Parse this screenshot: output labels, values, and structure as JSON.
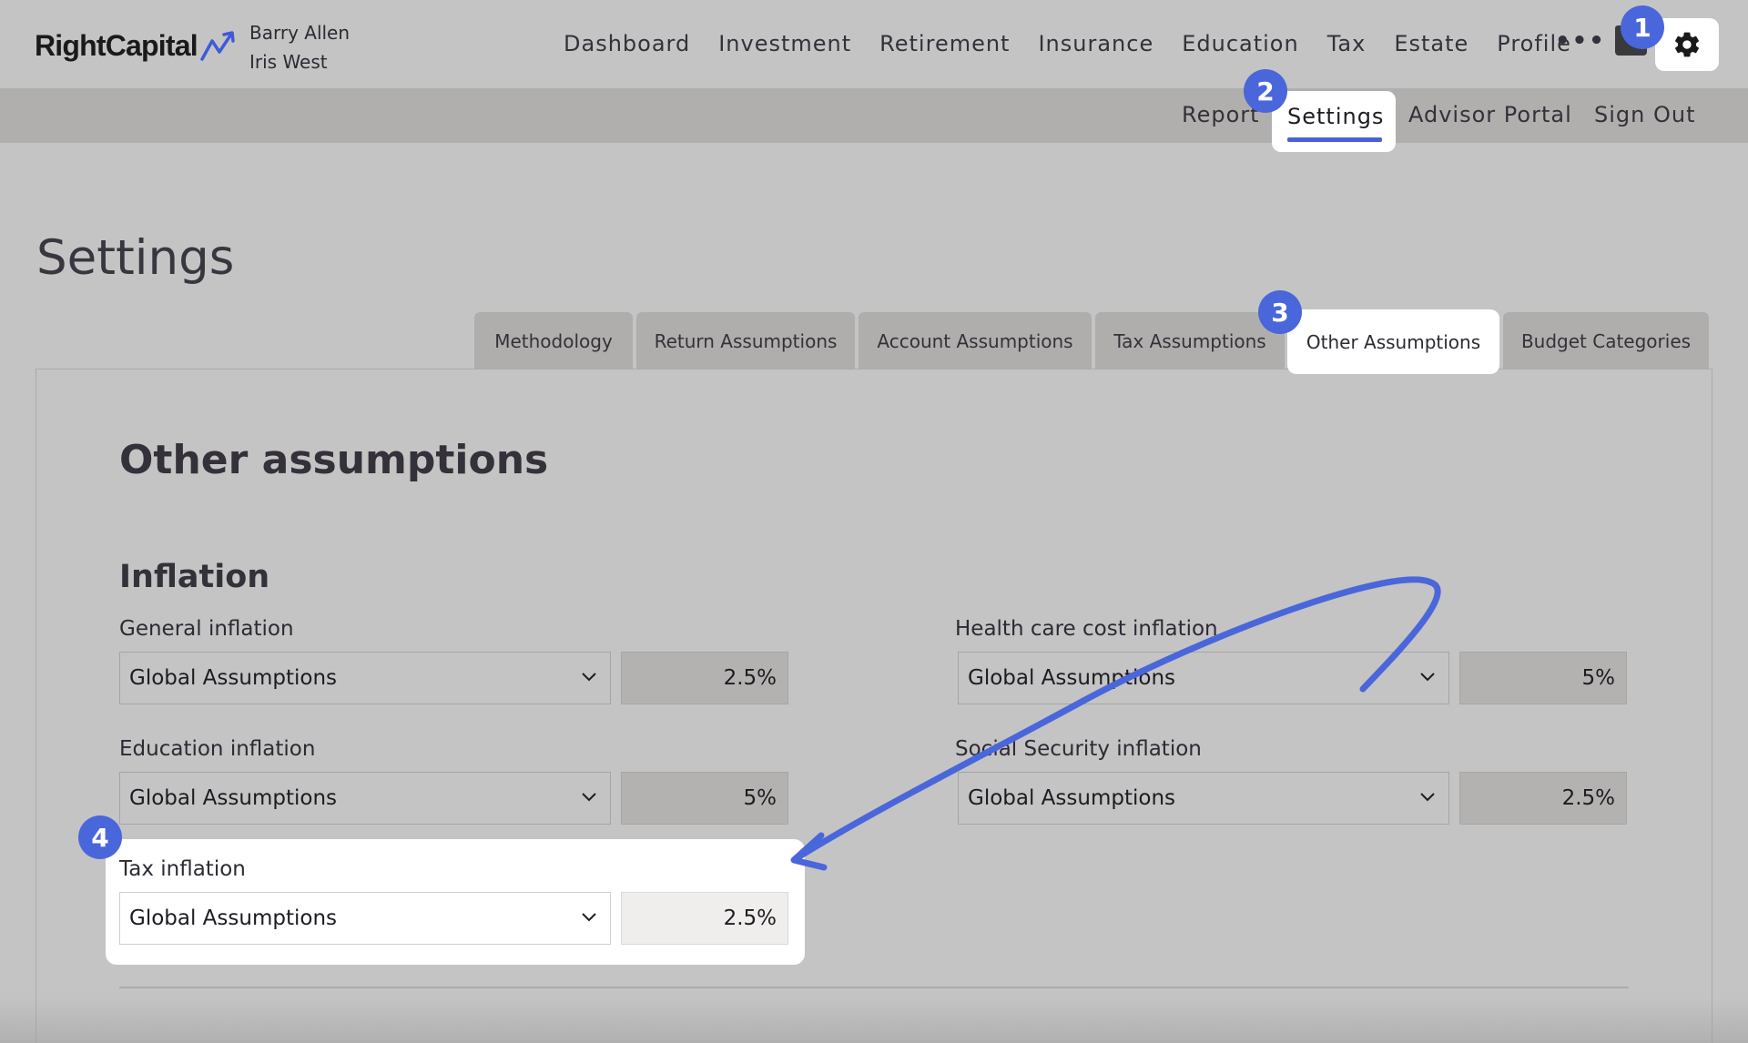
{
  "header": {
    "logo_text": "RightCapital",
    "clients": [
      "Barry Allen",
      "Iris West"
    ],
    "nav": [
      "Dashboard",
      "Investment",
      "Retirement",
      "Insurance",
      "Education",
      "Tax",
      "Estate",
      "Profile"
    ],
    "more": "•••"
  },
  "subnav": {
    "items": [
      "Report",
      "Settings",
      "Advisor Portal",
      "Sign Out"
    ],
    "active": "Settings"
  },
  "page": {
    "title": "Settings",
    "tabs": [
      "Methodology",
      "Return Assumptions",
      "Account Assumptions",
      "Tax Assumptions",
      "Other Assumptions",
      "Budget Categories"
    ],
    "active_tab": "Other Assumptions",
    "section_title": "Other assumptions",
    "group_title": "Inflation"
  },
  "fields": {
    "general": {
      "label": "General inflation",
      "source": "Global Assumptions",
      "value": "2.5%"
    },
    "health": {
      "label": "Health care cost inflation",
      "source": "Global Assumptions",
      "value": "5%"
    },
    "education": {
      "label": "Education inflation",
      "source": "Global Assumptions",
      "value": "5%"
    },
    "social_security": {
      "label": "Social Security inflation",
      "source": "Global Assumptions",
      "value": "2.5%"
    },
    "tax": {
      "label": "Tax inflation",
      "source": "Global Assumptions",
      "value": "2.5%"
    }
  },
  "badges": [
    "1",
    "2",
    "3",
    "4"
  ],
  "colors": {
    "accent": "#4a66db",
    "overlay": "#c4c4c4",
    "highlight": "#ffffff"
  },
  "icons": [
    "logo-arrow-icon",
    "more-icon",
    "folder-icon",
    "gear-icon",
    "chevron-down-icon",
    "annotation-arrow-icon"
  ]
}
